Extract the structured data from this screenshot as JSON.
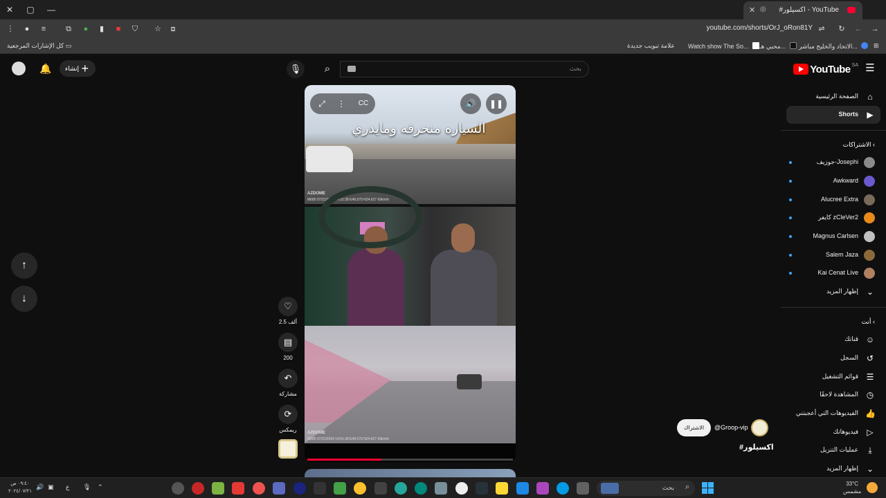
{
  "browser": {
    "tab_title": "#اكسيلور - YouTube",
    "url": "youtube.com/shorts/OrJ_oRon81Y",
    "new_tab": "+",
    "bookmarks": [
      "كل الإشارات المرجعية",
      "علامة تبويب جديدة",
      "Watch show The So...",
      "محبي هـ...",
      "الاتحاد والخليج مباشر..."
    ]
  },
  "masthead": {
    "logo_text": "YouTube",
    "region": "SA",
    "search_placeholder": "بحث",
    "create_label": "إنشاء"
  },
  "sidebar": {
    "main": [
      {
        "label": "الصفحة الرئيسية",
        "icon": "home-icon"
      },
      {
        "label": "Shorts",
        "icon": "shorts-icon",
        "active": true
      }
    ],
    "subscriptions_title": "الاشتراكات",
    "subscriptions": [
      {
        "name": "جوزيف-Josephi",
        "color": "#8b8b8b"
      },
      {
        "name": "Awkward",
        "color": "#6a5acd"
      },
      {
        "name": "Alucree Extra",
        "color": "#7a6a5a"
      },
      {
        "name": "كايفر zCleVer2",
        "color": "#e88a1a"
      },
      {
        "name": "Magnus Carlsen",
        "color": "#c0c0c0"
      },
      {
        "name": "Salem Jaza",
        "color": "#8a6a3a"
      },
      {
        "name": "Kai Cenat Live",
        "color": "#b08060"
      }
    ],
    "show_more_subs": "إظهار المزيد",
    "you_title": "أنت",
    "you_items": [
      {
        "label": "قناتك",
        "icon": "channel-icon"
      },
      {
        "label": "السجل",
        "icon": "history-icon"
      },
      {
        "label": "قوائم التشغيل",
        "icon": "playlists-icon"
      },
      {
        "label": "المشاهدة لاحقًا",
        "icon": "watch-later-icon"
      },
      {
        "label": "الفيديوهات التي أعجبتني",
        "icon": "like-icon"
      },
      {
        "label": "فيديوهاتك",
        "icon": "your-videos-icon"
      },
      {
        "label": "عمليات التنزيل",
        "icon": "downloads-icon"
      },
      {
        "label": "إظهار المزيد",
        "icon": "chevron-down-icon"
      }
    ]
  },
  "short": {
    "overlay_text": "السياره منحرقه ومايدري",
    "dashcam_brand": "AZDOME",
    "dashcam_date": "M680 07/21/2024 14:51:38 E49.579 N24.627 69km/h",
    "progress_fraction": 0.36,
    "likes": "2.5 ألف",
    "comments": "200",
    "share_label": "مشاركة",
    "remix_label": "ريمكس"
  },
  "channel": {
    "handle": "@Groop-vip",
    "subscribe_label": "الاشتراك",
    "hashtag": "#اكسيلور"
  },
  "taskbar": {
    "search_label": "بحث",
    "weather_temp": "33°C",
    "weather_desc": "مشمس",
    "time": "٠٩:٤٠ ص",
    "date": "٢٠٢٤/٠٧/٢١",
    "lang": "ع"
  },
  "colors": {
    "accent": "#ff0033",
    "background": "#0f0f0f",
    "surface": "#272727"
  }
}
